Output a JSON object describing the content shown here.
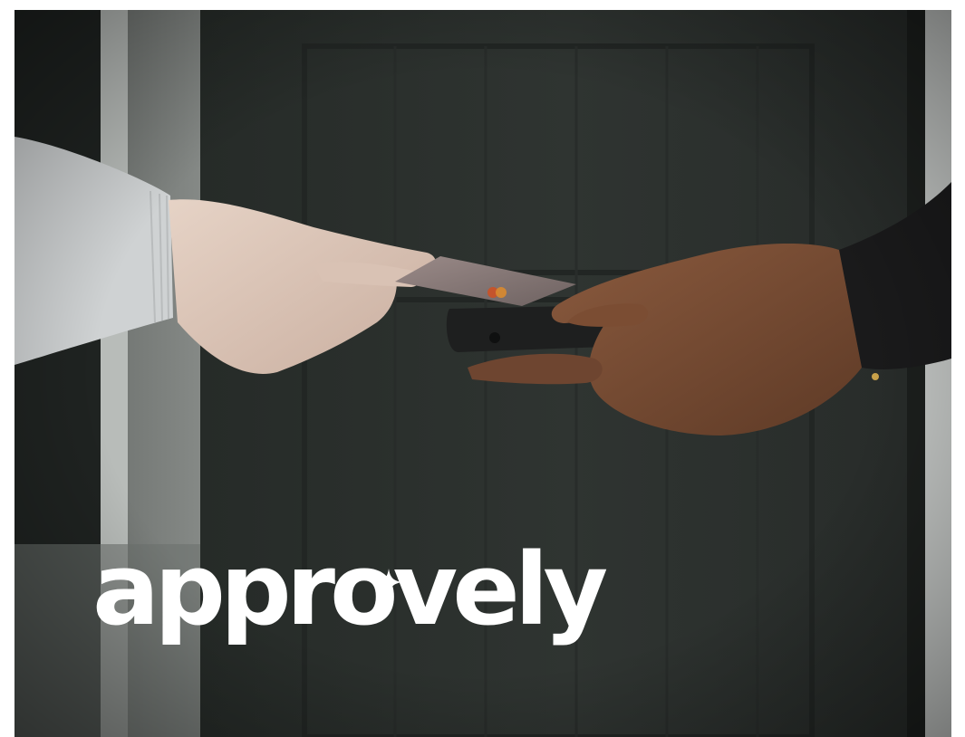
{
  "brand": {
    "wordmark": "approvely",
    "mark_icon": "sparkle-star-icon",
    "color": "#ffffff"
  },
  "scene": {
    "background": "#262a28",
    "door_color": "#2c312e",
    "wall_color": "#c9ccc9",
    "card_color": "#8a7b7a",
    "terminal_color": "#1e1f1f"
  }
}
